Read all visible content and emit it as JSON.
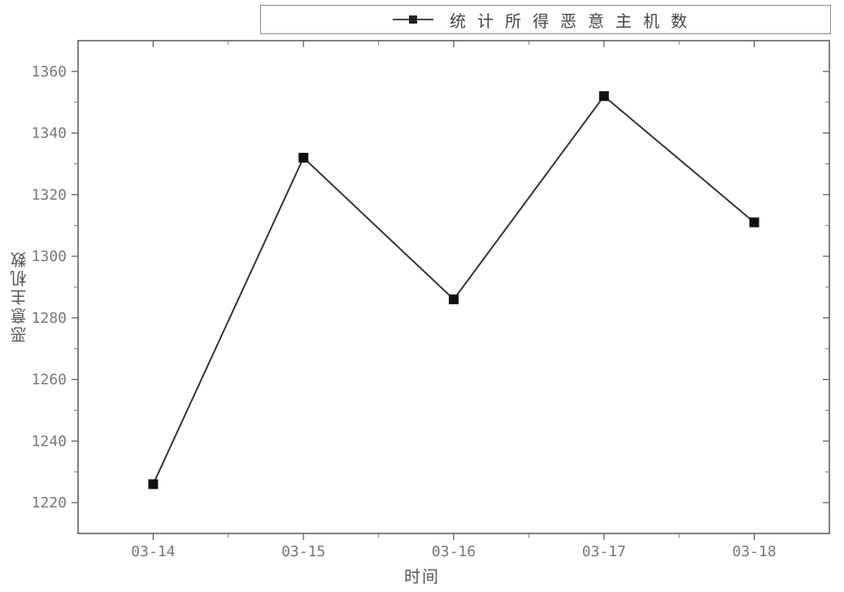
{
  "chart_data": {
    "type": "line",
    "title": "",
    "xlabel": "时间",
    "ylabel": "恶意主机数",
    "legend": "统计所得恶意主机数",
    "categories": [
      "03-14",
      "03-15",
      "03-16",
      "03-17",
      "03-18"
    ],
    "values": [
      1226,
      1332,
      1286,
      1352,
      1311
    ],
    "y_ticks": [
      1220,
      1240,
      1260,
      1280,
      1300,
      1320,
      1340,
      1360
    ],
    "ylim": [
      1210,
      1370
    ],
    "marker": "square"
  }
}
